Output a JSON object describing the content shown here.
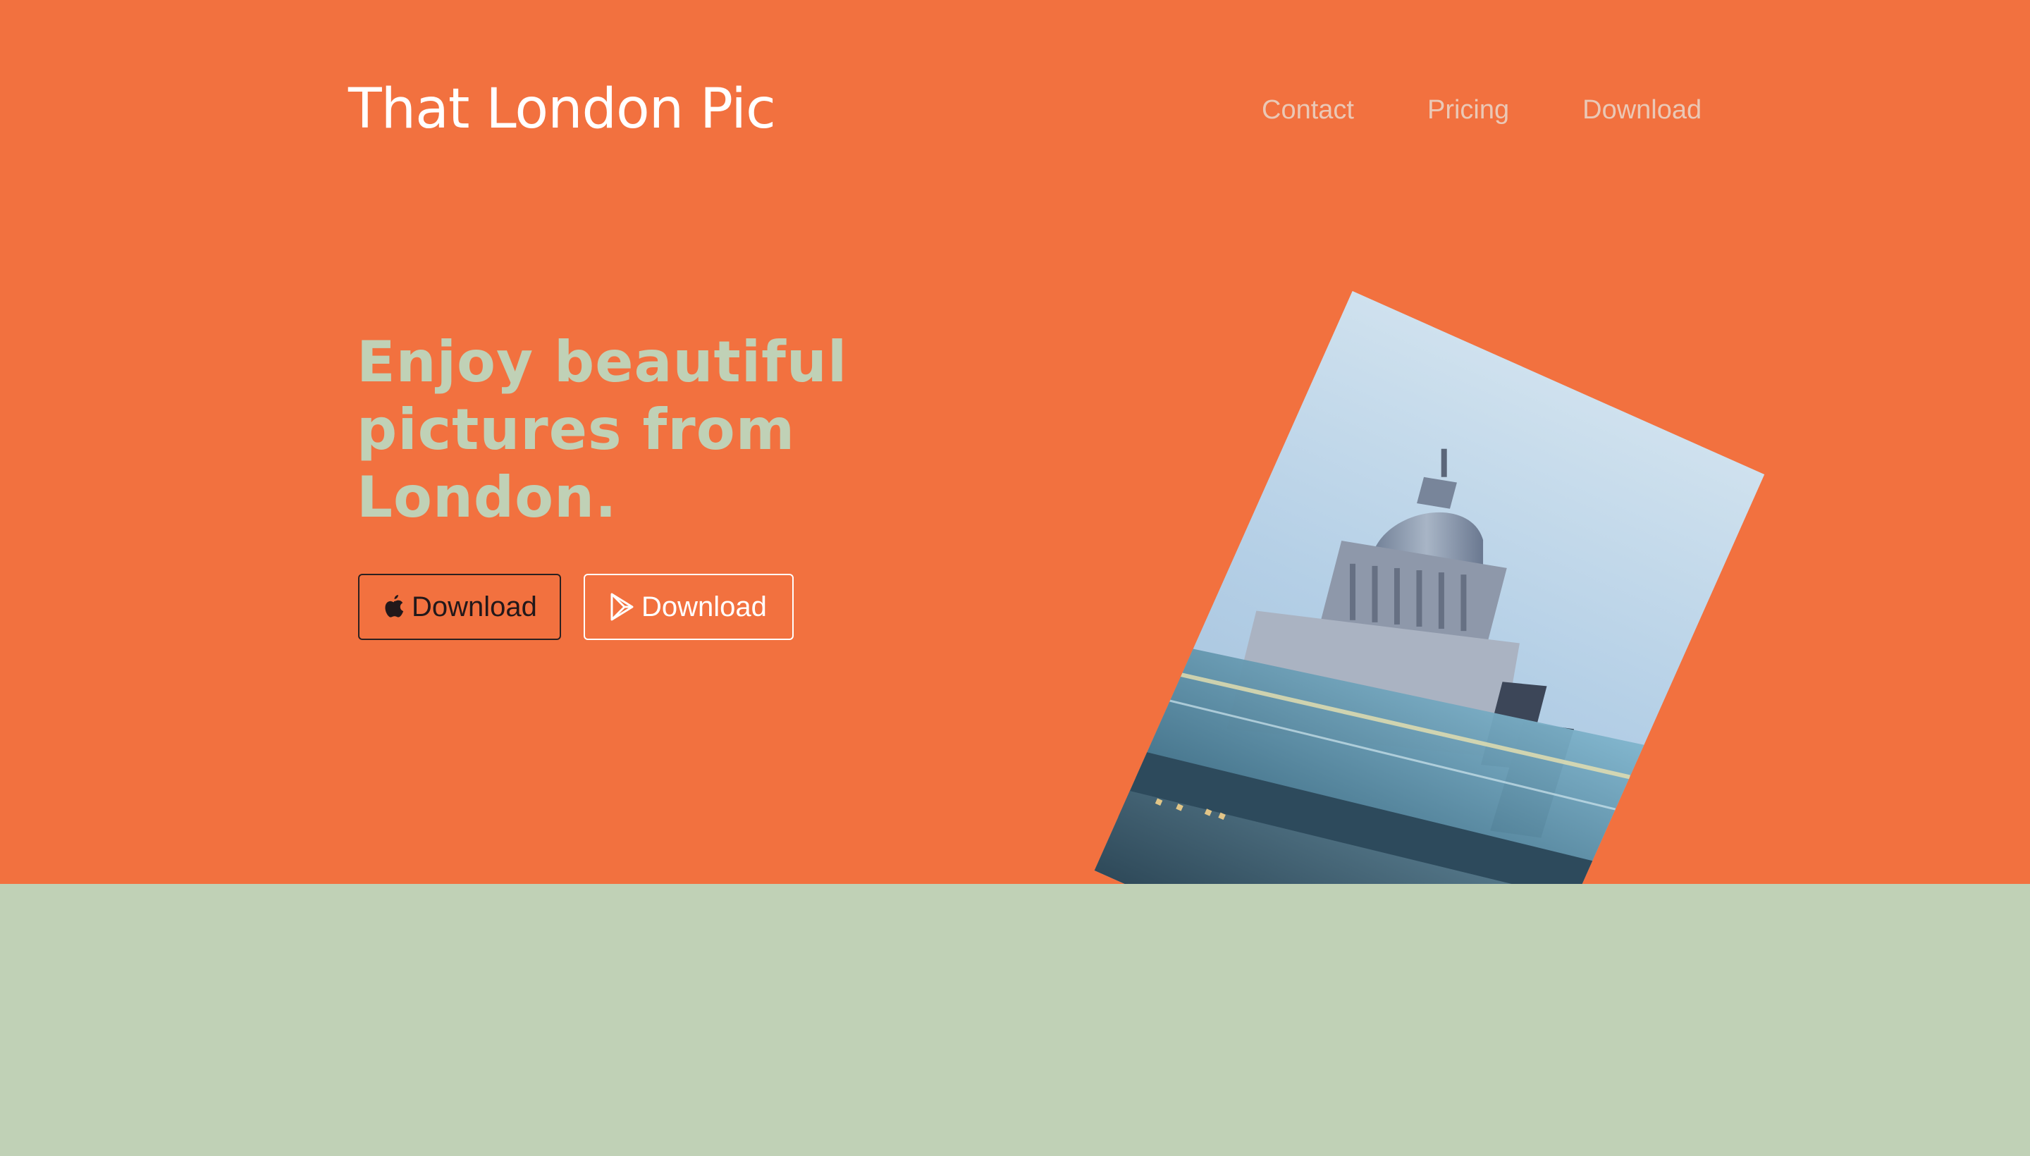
{
  "header": {
    "brand": "That London Pic",
    "nav": [
      {
        "label": "Contact"
      },
      {
        "label": "Pricing"
      },
      {
        "label": "Download"
      }
    ]
  },
  "hero": {
    "headline_lines": [
      "Enjoy beautiful",
      "pictures from",
      "London."
    ],
    "buttons": [
      {
        "label": "Download",
        "icon": "apple-icon"
      },
      {
        "label": "Download",
        "icon": "google-play-icon"
      }
    ],
    "photo_subject": "St Paul's Cathedral and Millennium Bridge"
  },
  "colors": {
    "hero_background": "#f2713f",
    "section_background": "#c0d1b6",
    "headline": "#c0d1b6",
    "nav_link": "#eac8b6"
  }
}
